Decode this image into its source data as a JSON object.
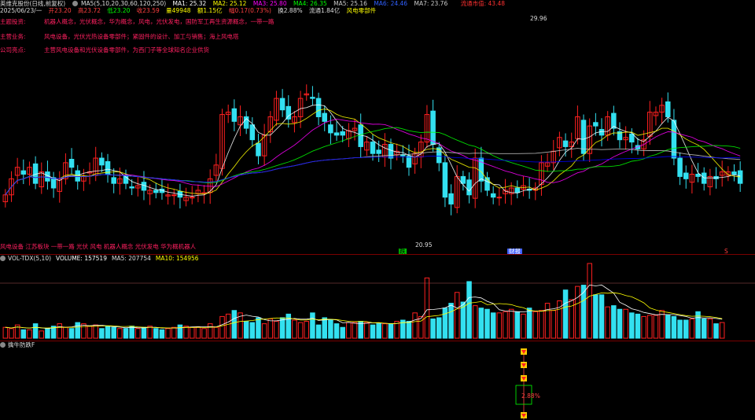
{
  "header": {
    "stock_title": "英维克股份(日线,前复权)",
    "ma_label": "MA5(5,10,20,30,60,120,250)",
    "ma1": "MA1: 25.32",
    "ma2": "MA2: 25.12",
    "ma3": "MA3: 25.80",
    "ma4": "MA4: 26.35",
    "ma5": "MA5: 25.16",
    "ma6": "MA6: 24.46",
    "ma7": "MA7: 23.76",
    "right_tag": "流通市值: 43.48",
    "date": "2025/06/23/一",
    "open": "开23.20",
    "high": "高23.72",
    "low": "低23.20",
    "close": "收23.59",
    "volume": "量49948",
    "amount": "额1.15亿",
    "change": "幅0.17(0.73%)",
    "turnover": "换2.88%",
    "float_mv": "流通1.84亿",
    "sector": "风电零部件",
    "colors": {
      "ma1": "#ffffff",
      "ma2": "#ffff00",
      "ma3": "#ff00ff",
      "ma4": "#00ff00",
      "ma5": "#cccccc",
      "ma6": "#0000ff",
      "ma7": "#bbbbbb"
    }
  },
  "info_lines": [
    {
      "key": "主题投资:",
      "value": "机器人概念，光伏概念，华为概念，风电，光伏发电，国防军工再生资源概念，一带一路"
    },
    {
      "key": "主营业务:",
      "value": "风电设备，光伏光热设备零部件；紧固件的设计、加工与销售；海上风电塔"
    },
    {
      "key": "公司亮点:",
      "value": "主营风电设备和光伏设备零部件，为西门子等全球知名企业供货"
    }
  ],
  "chart_labels": {
    "high_marker": "29.96",
    "low_marker": "20.95",
    "bottom_tags": "风电设备 江苏板块 一带一路 光伏 风电 机器人概念 光伏发电 华为概机器人",
    "flag_left": "跌",
    "flag_mid": "财报",
    "flag_right": "S"
  },
  "volume_panel": {
    "title": "VOL-TDX(5,10)",
    "volume": "VOLUME: 157519",
    "ma5": "MA5: 207754",
    "ma10": "MA10: 154956"
  },
  "bottom_panel": {
    "title": "擒牛防跌F",
    "value_label": "2.88%"
  },
  "chart_data": {
    "type": "candlestick",
    "x": [
      1,
      2,
      3,
      4,
      5,
      6,
      7,
      8,
      9,
      10,
      11,
      12,
      13,
      14,
      15,
      16,
      17,
      18,
      19,
      20,
      21,
      22,
      23,
      24,
      25,
      26,
      27,
      28,
      29,
      30,
      31,
      32,
      33,
      34,
      35,
      36,
      37,
      38,
      39,
      40,
      41,
      42,
      43,
      44,
      45,
      46,
      47,
      48,
      49,
      50,
      51,
      52,
      53,
      54,
      55,
      56,
      57,
      58,
      59,
      60,
      61,
      62,
      63,
      64,
      65,
      66,
      67,
      68,
      69,
      70,
      71,
      72,
      73,
      74,
      75,
      76,
      77,
      78,
      79,
      80,
      81,
      82,
      83,
      84,
      85,
      86,
      87,
      88,
      89,
      90,
      91,
      92,
      93,
      94,
      95,
      96,
      97,
      98,
      99,
      100,
      101,
      102,
      103,
      104,
      105,
      106,
      107,
      108,
      109,
      110,
      111,
      112,
      113,
      114,
      115,
      116,
      117,
      118,
      119,
      120,
      121,
      122,
      123,
      124,
      125,
      126,
      127,
      128,
      129,
      130,
      131,
      132,
      133,
      134,
      135,
      136,
      137,
      138,
      139,
      140,
      141,
      142,
      143,
      144,
      145,
      146,
      147,
      148,
      149,
      150,
      151,
      152,
      153,
      154,
      155,
      156,
      157,
      158,
      159,
      160
    ],
    "close": [
      22.7,
      23.4,
      23.9,
      23.6,
      23.9,
      23.2,
      23.7,
      23.3,
      23.0,
      23.4,
      24.1,
      23.9,
      23.3,
      23.5,
      23.7,
      24.3,
      24.0,
      23.6,
      23.2,
      23.4,
      23.2,
      23.0,
      23.1,
      22.9,
      22.9,
      22.8,
      22.8,
      22.7,
      22.7,
      22.6,
      22.6,
      22.6,
      22.9,
      22.8,
      23.4,
      24.0,
      26.2,
      26.3,
      25.9,
      26.1,
      25.6,
      25.1,
      24.4,
      25.3,
      26.1,
      26.9,
      26.4,
      26.0,
      26.1,
      26.9,
      27.1,
      26.9,
      26.1,
      25.9,
      25.4,
      25.3,
      25.3,
      25.5,
      25.6,
      24.8,
      25.0,
      24.5,
      24.5,
      24.9,
      24.3,
      24.6,
      24.4,
      23.9,
      24.5,
      25.0,
      26.2,
      24.9,
      24.1,
      22.6,
      22.3,
      23.5,
      23.2,
      22.7,
      24.3,
      23.3,
      22.9,
      22.6,
      22.6,
      22.9,
      23.0,
      22.8,
      23.1,
      22.9,
      23.0,
      24.1,
      24.1,
      24.6,
      25.2,
      24.8,
      25.0,
      26.1,
      24.5,
      25.7,
      25.7,
      25.3,
      26.1,
      25.6,
      25.1,
      25.2,
      25.0,
      24.7,
      25.1,
      26.3,
      26.3,
      26.6,
      26.1,
      24.3,
      23.5,
      23.4,
      23.6,
      23.5,
      23.2,
      23.5,
      23.4,
      23.7,
      23.7,
      23.6,
      23.2
    ],
    "volume": [
      9,
      8,
      11,
      7,
      7,
      12,
      6,
      8,
      10,
      12,
      9,
      8,
      13,
      12,
      10,
      11,
      8,
      10,
      9,
      8,
      8,
      10,
      8,
      9,
      10,
      8,
      7,
      8,
      9,
      11,
      10,
      9,
      9,
      8,
      12,
      9,
      18,
      20,
      23,
      21,
      14,
      13,
      17,
      12,
      16,
      14,
      17,
      20,
      15,
      13,
      14,
      21,
      11,
      17,
      15,
      12,
      9,
      13,
      13,
      14,
      13,
      11,
      12,
      12,
      12,
      14,
      15,
      14,
      21,
      18,
      50,
      16,
      17,
      25,
      29,
      38,
      30,
      47,
      27,
      25,
      24,
      21,
      21,
      22,
      24,
      22,
      20,
      25,
      22,
      23,
      29,
      23,
      31,
      40,
      32,
      43,
      44,
      62,
      36,
      36,
      26,
      27,
      24,
      24,
      21,
      20,
      18,
      19,
      19,
      23,
      19,
      18,
      15,
      15,
      16,
      22,
      16,
      16,
      12,
      13
    ],
    "ylim": [
      20.5,
      30.5
    ]
  }
}
